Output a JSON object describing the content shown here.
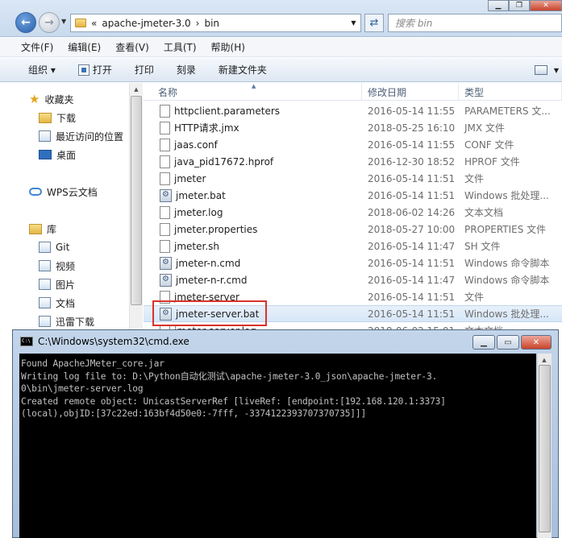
{
  "address": {
    "back_icon": "arrow-left-icon",
    "forward_icon": "arrow-right-icon",
    "path_prefix": "«",
    "path_segments": [
      "apache-jmeter-3.0",
      "bin"
    ],
    "separator": "›",
    "search_placeholder": "搜索 bin"
  },
  "menubar": [
    "文件(F)",
    "编辑(E)",
    "查看(V)",
    "工具(T)",
    "帮助(H)"
  ],
  "toolbar": {
    "organize": "组织 ▾",
    "open": "打开",
    "print": "打印",
    "burn": "刻录",
    "new_folder": "新建文件夹"
  },
  "nav": {
    "favorites": "收藏夹",
    "downloads": "下载",
    "recent": "最近访问的位置",
    "desktop": "桌面",
    "wps": "WPS云文档",
    "library": "库",
    "git": "Git",
    "video": "视频",
    "pictures": "图片",
    "documents": "文档",
    "xunlei": "迅雷下载"
  },
  "columns": {
    "name": "名称",
    "date": "修改日期",
    "type": "类型"
  },
  "files": [
    {
      "name": "httpclient.parameters",
      "date": "2016-05-14 11:55",
      "type": "PARAMETERS 文...",
      "icon": "file"
    },
    {
      "name": "HTTP请求.jmx",
      "date": "2018-05-25 16:10",
      "type": "JMX 文件",
      "icon": "file"
    },
    {
      "name": "jaas.conf",
      "date": "2016-05-14 11:55",
      "type": "CONF 文件",
      "icon": "file"
    },
    {
      "name": "java_pid17672.hprof",
      "date": "2016-12-30 18:52",
      "type": "HPROF 文件",
      "icon": "file"
    },
    {
      "name": "jmeter",
      "date": "2016-05-14 11:51",
      "type": "文件",
      "icon": "file"
    },
    {
      "name": "jmeter.bat",
      "date": "2016-05-14 11:51",
      "type": "Windows 批处理...",
      "icon": "bat"
    },
    {
      "name": "jmeter.log",
      "date": "2018-06-02 14:26",
      "type": "文本文档",
      "icon": "file"
    },
    {
      "name": "jmeter.properties",
      "date": "2018-05-27 10:00",
      "type": "PROPERTIES 文件",
      "icon": "file"
    },
    {
      "name": "jmeter.sh",
      "date": "2016-05-14 11:47",
      "type": "SH 文件",
      "icon": "file"
    },
    {
      "name": "jmeter-n.cmd",
      "date": "2016-05-14 11:51",
      "type": "Windows 命令脚本",
      "icon": "bat"
    },
    {
      "name": "jmeter-n-r.cmd",
      "date": "2016-05-14 11:47",
      "type": "Windows 命令脚本",
      "icon": "bat"
    },
    {
      "name": "jmeter-server",
      "date": "2016-05-14 11:51",
      "type": "文件",
      "icon": "file"
    },
    {
      "name": "jmeter-server.bat",
      "date": "2016-05-14 11:51",
      "type": "Windows 批处理...",
      "icon": "bat"
    },
    {
      "name": "jmeter-server.log",
      "date": "2018-06-02 15:01",
      "type": "文本文档",
      "icon": "file"
    }
  ],
  "selected_file": "jmeter-server.bat",
  "cmd": {
    "title": "C:\\Windows\\system32\\cmd.exe",
    "icon_text": "C:\\",
    "lines": [
      "Found ApacheJMeter_core.jar",
      "Writing log file to: D:\\Python自动化测试\\apache-jmeter-3.0_json\\apache-jmeter-3.",
      "0\\bin\\jmeter-server.log",
      "Created remote object: UnicastServerRef [liveRef: [endpoint:[192.168.120.1:3373]",
      "(local),objID:[37c22ed:163bf4d50e0:-7fff, -3374122393707370735]]]"
    ]
  },
  "colors": {
    "highlight": "#d9322b",
    "cmd_bg": "#000000",
    "cmd_text": "#c0c0c0"
  }
}
